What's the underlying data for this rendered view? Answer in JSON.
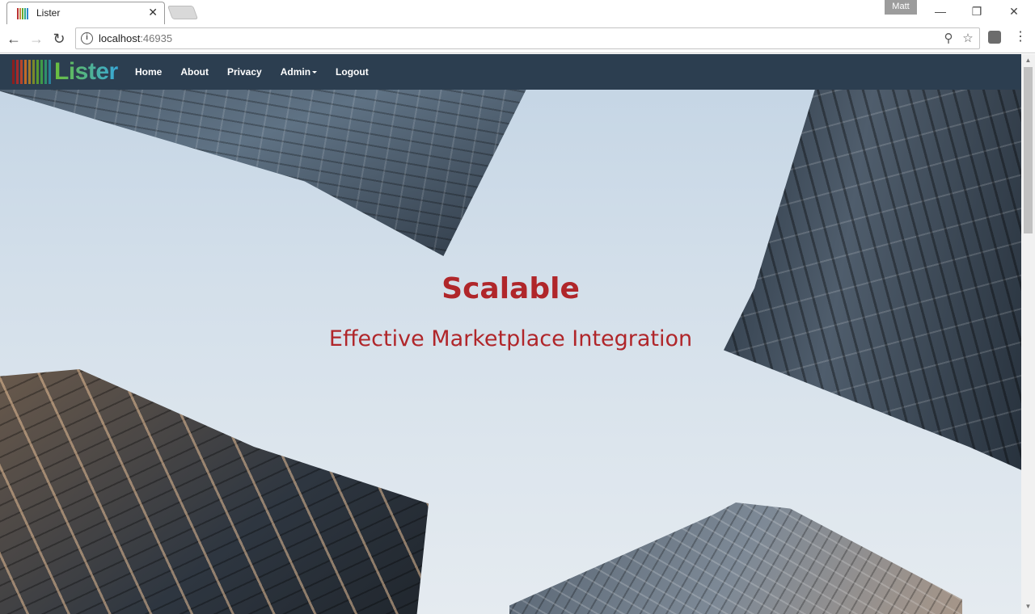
{
  "browser": {
    "tab_title": "Lister",
    "tab_close": "✕",
    "profile_name": "Matt",
    "window_controls": {
      "minimize": "—",
      "restore": "❐",
      "close": "✕"
    },
    "url_host": "localhost",
    "url_port": ":46935",
    "icons": [
      "info-icon",
      "zoom-icon",
      "star-icon",
      "extension-icon",
      "menu-icon",
      "back-icon",
      "forward-icon",
      "reload-icon"
    ]
  },
  "site": {
    "brand": "Lister",
    "nav": [
      {
        "label": "Home"
      },
      {
        "label": "About"
      },
      {
        "label": "Privacy"
      },
      {
        "label": "Admin"
      },
      {
        "label": "Logout"
      }
    ],
    "colors": {
      "navbar": "#2c3e50",
      "hero_text": "#b0262a"
    }
  },
  "hero": {
    "title": "Scalable",
    "subtitle": "Effective Marketplace Integration"
  }
}
